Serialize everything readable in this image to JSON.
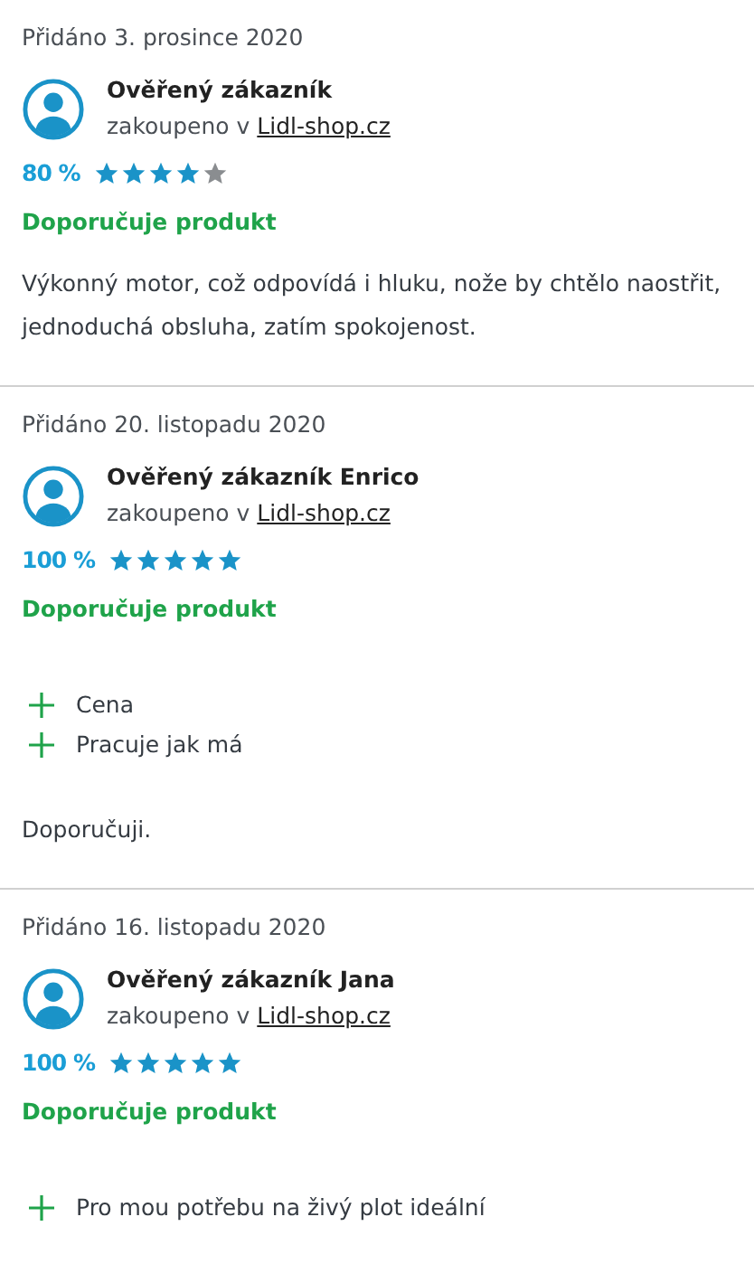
{
  "reviews": [
    {
      "date": "Přidáno 3. prosince 2020",
      "author": "Ověřený zákazník",
      "purchased_prefix": "zakoupeno v",
      "shop_link": "Lidl-shop.cz",
      "percent": "80 %",
      "stars": 4,
      "recommendation": "Doporučuje produkt",
      "text": "Výkonný motor, což odpovídá i hluku, nože by chtělo naostřit, jednoduchá obsluha, zatím spokojenost."
    },
    {
      "date": "Přidáno 20. listopadu 2020",
      "author": "Ověřený zákazník Enrico",
      "purchased_prefix": "zakoupeno v",
      "shop_link": "Lidl-shop.cz",
      "percent": "100 %",
      "stars": 5,
      "recommendation": "Doporučuje produkt",
      "pros": [
        "Cena",
        "Pracuje jak má"
      ],
      "text": "Doporučuji."
    },
    {
      "date": "Přidáno 16. listopadu 2020",
      "author": "Ověřený zákazník Jana",
      "purchased_prefix": "zakoupeno v",
      "shop_link": "Lidl-shop.cz",
      "percent": "100 %",
      "stars": 5,
      "recommendation": "Doporučuje produkt",
      "pros": [
        "Pro mou potřebu na živý plot ideální"
      ]
    }
  ]
}
